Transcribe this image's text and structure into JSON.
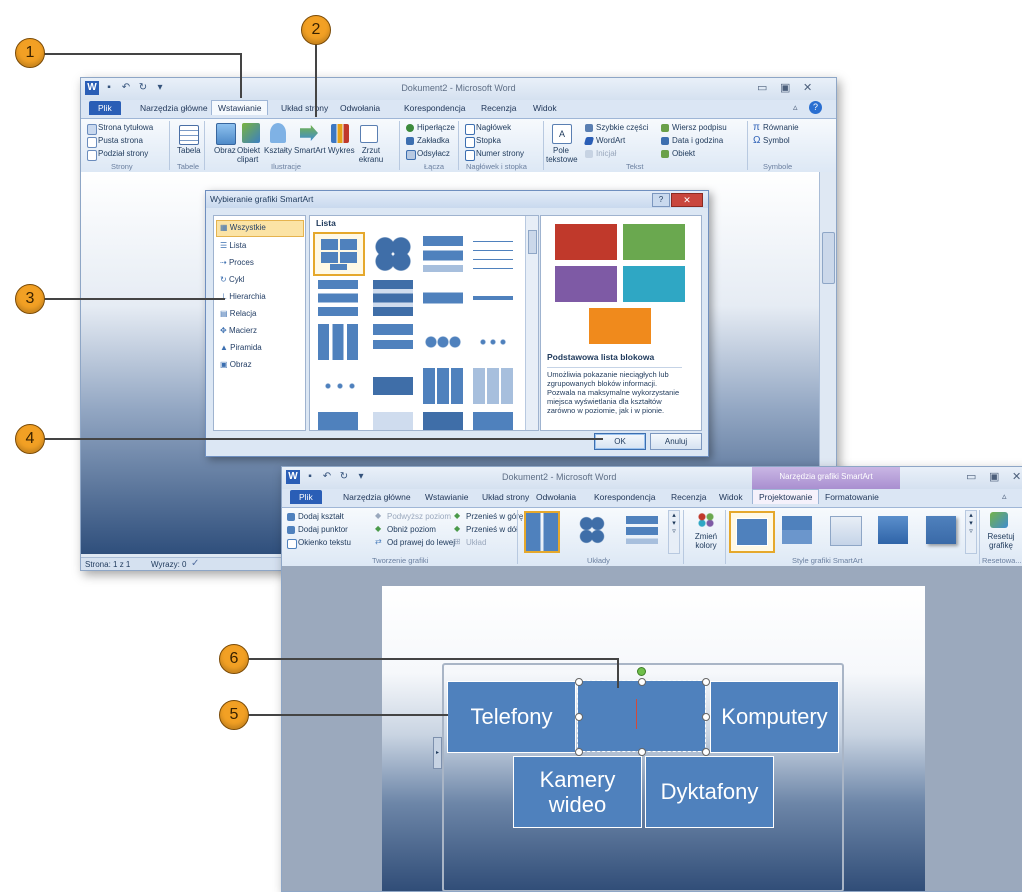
{
  "callouts": [
    "1",
    "2",
    "3",
    "4",
    "5",
    "6"
  ],
  "window1": {
    "title": "Dokument2 - Microsoft Word",
    "tabs": {
      "file": "Plik",
      "home": "Narzędzia główne",
      "insert": "Wstawianie",
      "layout": "Układ strony",
      "refs": "Odwołania",
      "mail": "Korespondencja",
      "review": "Recenzja",
      "view": "Widok"
    },
    "ribbon": {
      "pages": {
        "cover": "Strona tytułowa",
        "blank": "Pusta strona",
        "break": "Podział strony",
        "group": "Strony"
      },
      "tables": {
        "table": "Tabela",
        "group": "Tabele"
      },
      "illus": {
        "picture": "Obraz",
        "clipart": "Obiekt clipart",
        "shapes": "Kształty",
        "smartart": "SmartArt",
        "chart": "Wykres",
        "screenshot": "Zrzut ekranu",
        "group": "Ilustracje"
      },
      "links": {
        "hyperlink": "Hiperłącze",
        "bookmark": "Zakładka",
        "xref": "Odsyłacz",
        "group": "Łącza"
      },
      "hf": {
        "header": "Nagłówek",
        "footer": "Stopka",
        "pagenum": "Numer strony",
        "group": "Nagłówek i stopka"
      },
      "text": {
        "textbox": "Pole tekstowe",
        "quickparts": "Szybkie części",
        "wordart": "WordArt",
        "dropcap": "Inicjał",
        "sigline": "Wiersz podpisu",
        "datetime": "Data i godzina",
        "object": "Obiekt",
        "group": "Tekst"
      },
      "symbols": {
        "equation": "Równanie",
        "symbol": "Symbol",
        "group": "Symbole"
      }
    },
    "status": {
      "page": "Strona: 1 z 1",
      "words": "Wyrazy: 0"
    }
  },
  "dialog": {
    "title": "Wybieranie grafiki SmartArt",
    "categories": [
      "Wszystkie",
      "Lista",
      "Proces",
      "Cykl",
      "Hierarchia",
      "Relacja",
      "Macierz",
      "Piramida",
      "Obraz"
    ],
    "list_header": "Lista",
    "preview_title": "Podstawowa lista blokowa",
    "preview_desc": "Umożliwia pokazanie nieciągłych lub zgrupowanych bloków informacji. Pozwala na maksymalne wykorzystanie miejsca wyświetlania dla kształtów zarówno w poziomie, jak i w pionie.",
    "ok": "OK",
    "cancel": "Anuluj"
  },
  "window2": {
    "title": "Dokument2 - Microsoft Word",
    "context_title": "Narzędzia grafiki SmartArt",
    "tabs": {
      "file": "Plik",
      "home": "Narzędzia główne",
      "insert": "Wstawianie",
      "layout": "Układ strony",
      "refs": "Odwołania",
      "mail": "Korespondencja",
      "review": "Recenzja",
      "view": "Widok",
      "design": "Projektowanie",
      "format": "Formatowanie"
    },
    "ribbon": {
      "addshape": "Dodaj kształt",
      "addbullet": "Dodaj punktor",
      "textpane": "Okienko tekstu",
      "promote": "Podwyższ poziom",
      "demote": "Obniż poziom",
      "rtl": "Od prawej do lewej",
      "moveup": "Przenieś w górę",
      "movedown": "Przenieś w dół",
      "layout": "Układ",
      "group_create": "Tworzenie grafiki",
      "group_layouts": "Układy",
      "changecolors": "Zmień kolory",
      "group_styles": "Style grafiki SmartArt",
      "reset": "Resetuj grafikę",
      "group_reset": "Resetowa..."
    },
    "shapes": [
      "Telefony",
      "",
      "Komputery",
      "Kamery wideo",
      "Dyktafony"
    ]
  },
  "colors": {
    "accent": "#4f81bd",
    "callout": "#f2a024",
    "file_tab": "#2a5eb6",
    "context": "#9a7cc4"
  }
}
